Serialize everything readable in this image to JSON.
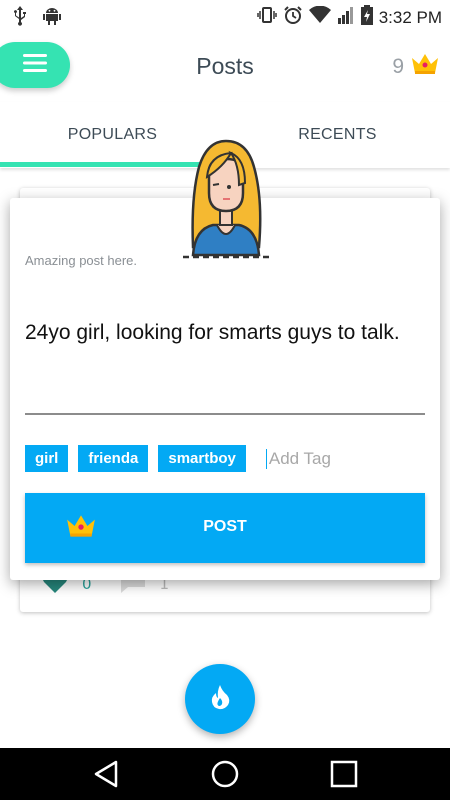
{
  "status_bar": {
    "time": "3:32 PM"
  },
  "header": {
    "title": "Posts",
    "crown_count": "9"
  },
  "tabs": [
    {
      "label": "POPULARS",
      "active": true
    },
    {
      "label": "RECENTS",
      "active": false
    }
  ],
  "background_card": {
    "likes": "0",
    "comments": "1"
  },
  "dialog": {
    "hint": "Amazing post here.",
    "body": "24yo girl, looking for smarts guys to talk.",
    "tags": [
      "girl",
      "frienda",
      "smartboy"
    ],
    "add_tag_placeholder": "Add Tag",
    "post_label": "POST"
  },
  "colors": {
    "accent_green": "#35e3b2",
    "primary_blue": "#03a9f4",
    "crown_gold": "#ffc107",
    "title_text": "#3d4b56"
  },
  "icons": [
    "usb-icon",
    "android-icon",
    "vibrate-icon",
    "alarm-icon",
    "wifi-icon",
    "signal-icon",
    "battery-icon",
    "menu-icon",
    "crown-icon",
    "heart-icon",
    "comment-icon",
    "flame-icon",
    "back-icon",
    "home-icon",
    "recents-icon"
  ]
}
